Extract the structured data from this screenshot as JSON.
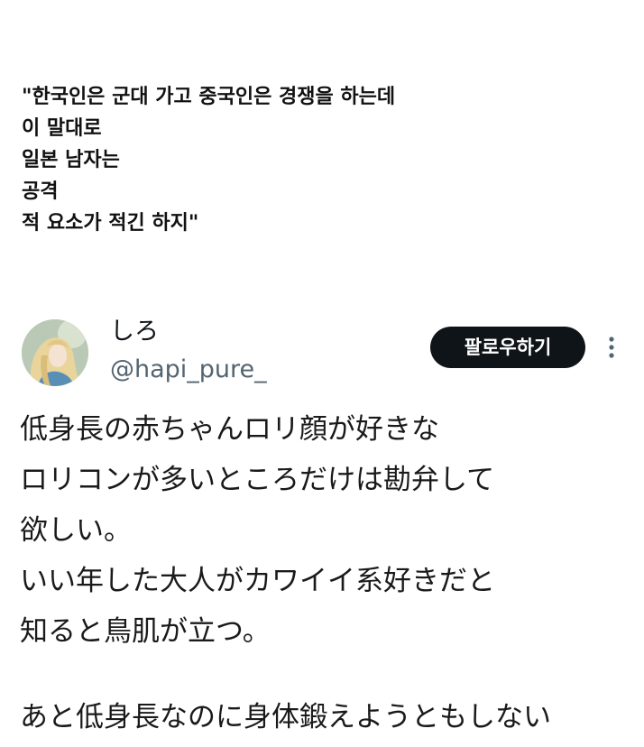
{
  "caption": {
    "lines": [
      "\"한국인은 군대 가고 중국인은 경쟁을 하는데",
      "이 말대로",
      "일본 남자는",
      "공격",
      "적 요소가 적긴 하지\""
    ]
  },
  "tweet": {
    "display_name": "しろ",
    "handle": "@hapi_pure_",
    "follow_label": "팔로우하기",
    "more_icon": "more-vertical-icon",
    "paragraph1": [
      "低身長の赤ちゃんロリ顔が好きな",
      "ロリコンが多いところだけは勘弁して",
      "欲しい。",
      "いい年した大人がカワイイ系好きだと",
      "知ると鳥肌が立つ。"
    ],
    "paragraph2": [
      "あと低身長なのに身体鍛えようともしない"
    ]
  },
  "colors": {
    "text": "#0f1419",
    "handle": "#536471",
    "button_bg": "#0f1419",
    "button_text": "#ffffff",
    "icon": "#536471"
  }
}
